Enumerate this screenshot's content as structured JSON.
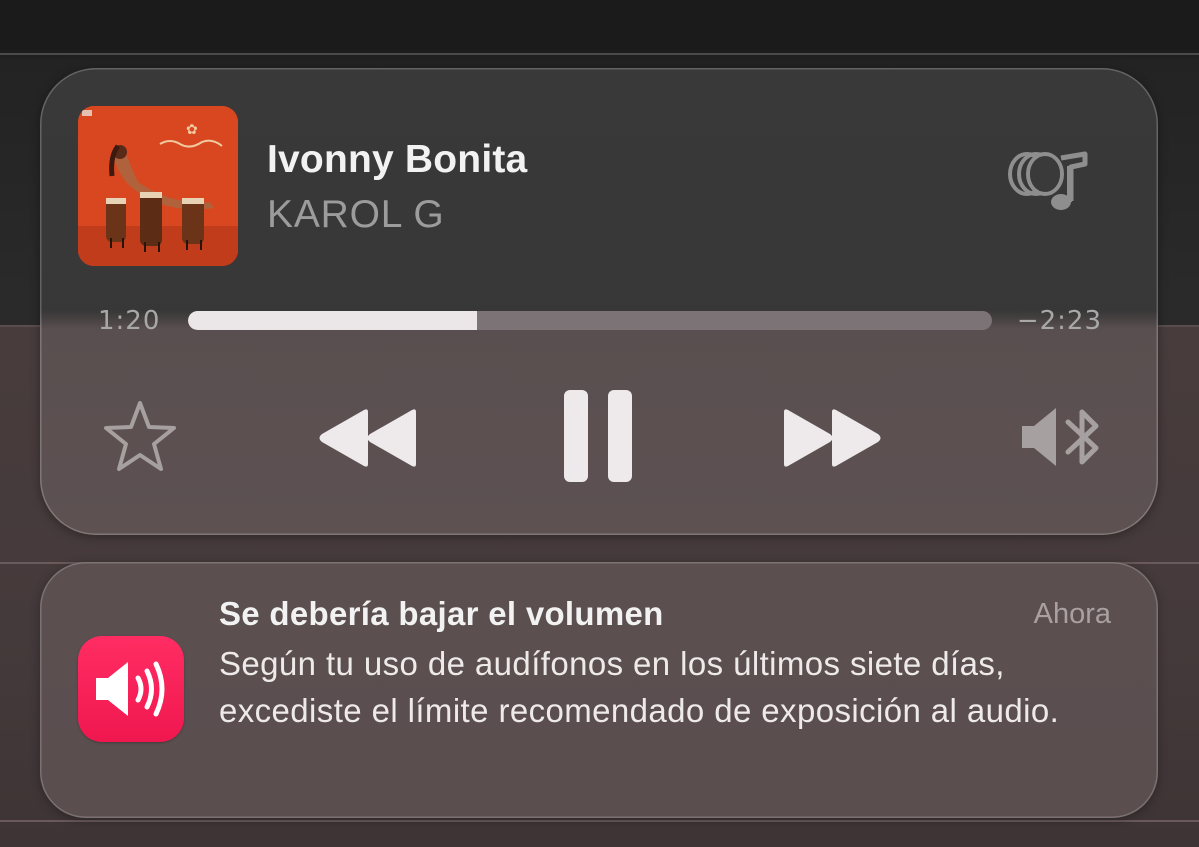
{
  "now_playing": {
    "title": "Ivonny Bonita",
    "artist": "KAROL G",
    "artwork": "album-artwork",
    "output_icon": "airplay-audio-icon",
    "elapsed": "1:20",
    "remaining": "−2:23",
    "progress": 0.36,
    "controls": {
      "favorite_icon": "star-icon",
      "rewind_icon": "rewind-icon",
      "play_pause_icon": "pause-icon",
      "forward_icon": "fast-forward-icon",
      "output_device_icon": "speaker-bluetooth-icon"
    }
  },
  "notification": {
    "app_icon": "speaker-volume-icon",
    "title": "Se debería bajar el volumen",
    "time": "Ahora",
    "body": "Según tu uso de audífonos en los últimos siete días, excediste el límite recomendado de exposición al audio."
  },
  "colors": {
    "progress_fill": "#ebe7e8",
    "progress_track": "#7b7375",
    "notification_icon": "#ff2d63",
    "primary_text": "#f2f2f2",
    "secondary_text": "#9c9c9c"
  }
}
